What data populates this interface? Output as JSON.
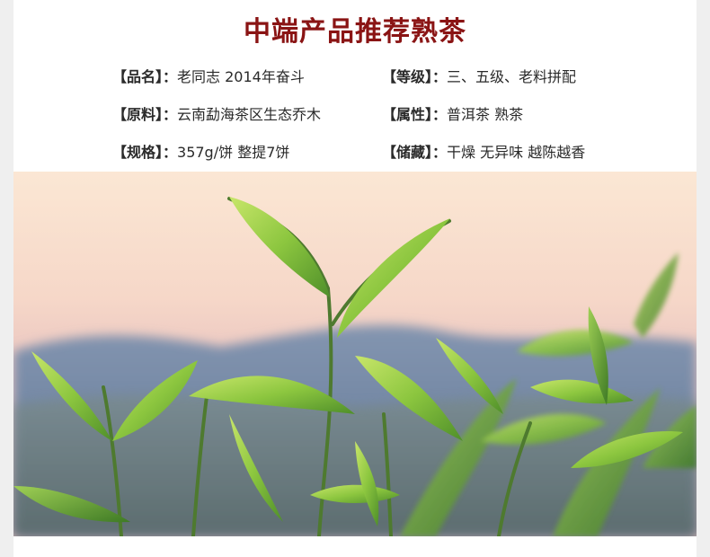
{
  "title": "中端产品推荐熟茶",
  "specs": {
    "name": {
      "label": "【品名】：",
      "value": "老同志 2014年奋斗"
    },
    "grade": {
      "label": "【等级】：",
      "value": "三、五级、老料拼配"
    },
    "material": {
      "label": "【原料】：",
      "value": "云南勐海茶区生态乔木"
    },
    "attr": {
      "label": "【属性】：",
      "value": "普洱茶 熟茶"
    },
    "spec": {
      "label": "【规格】：",
      "value": "357g/饼 整提7饼"
    },
    "storage": {
      "label": "【储藏】：",
      "value": "干燥 无异味 越陈越香"
    }
  },
  "colors": {
    "title": "#8a1414",
    "text": "#2a2a2a",
    "sky_top": "#f8dcc6",
    "mountain": "#6f86a6",
    "leaf": "#8cc63f"
  }
}
